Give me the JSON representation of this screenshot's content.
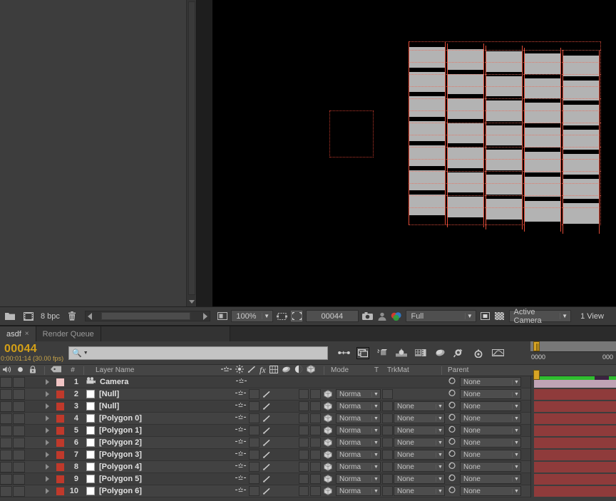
{
  "project_panel": {
    "bit_depth": "8 bpc",
    "folder_icon": "folder-icon",
    "comp_icon": "comp-icon",
    "delete_icon": "trash-icon"
  },
  "viewer_toolbar": {
    "region_icon": "region-of-interest-icon",
    "zoom": "100%",
    "grid_icon": "grid-guides-icon",
    "roi_icon": "region-crop-icon",
    "timecode": "00044",
    "snapshot_icon": "camera-icon",
    "show_snapshot_icon": "person-icon",
    "channels_icon": "channels-icon",
    "resolution": "Full",
    "mask_icon": "mask-icon",
    "transparency_icon": "transparency-grid-icon",
    "view": "Active Camera",
    "views": "1 View"
  },
  "tabs": [
    {
      "label": "asdf",
      "active": true,
      "close": "×"
    },
    {
      "label": "Render Queue",
      "active": false,
      "close": ""
    }
  ],
  "timeline": {
    "current_time": "00044",
    "time_detail": "0:00:01:14 (30.00 fps)",
    "search_placeholder": "",
    "search_value": "",
    "switches": [
      "live-update-icon",
      "draft-3d-icon",
      "motion-blur-icon",
      "graph-editor-icon",
      "hide-shy-icon",
      "frame-blend-icon",
      "brainstorm-icon",
      "auto-keyframe-icon"
    ],
    "ruler_labels": [
      "0000",
      "000"
    ],
    "columns": {
      "av_a": "audio-icon",
      "av_v": "eye-icon",
      "av_s": "solo-icon",
      "av_l": "lock-icon",
      "tag": "label-icon",
      "number": "#",
      "name": "Layer Name",
      "switch_icons": [
        "shy-icon",
        "collapse-icon",
        "quality-icon",
        "effects-icon",
        "frame-blend-icon",
        "motion-blur-icon",
        "adjustment-icon",
        "three-d-icon"
      ],
      "mode": "Mode",
      "t": "T",
      "trkmat": "TrkMat",
      "parent": "Parent"
    },
    "layers": [
      {
        "num": "1",
        "name": "Camera",
        "color": "#f0c4c4",
        "type": "camera",
        "icon": "camera-layer-icon",
        "mode": "",
        "trkmat": "",
        "parent": "None",
        "has_mode": false,
        "has_trkmat": false,
        "bar_color": "#bfa3b5"
      },
      {
        "num": "2",
        "name": "[Null]",
        "color": "#c0392b",
        "type": "null",
        "icon": "solid-icon",
        "mode": "Norma",
        "trkmat": "",
        "parent": "None",
        "has_mode": true,
        "has_trkmat": false,
        "bar_color": "#8f3b3b"
      },
      {
        "num": "3",
        "name": "[Null]",
        "color": "#c0392b",
        "type": "null",
        "icon": "solid-icon",
        "mode": "Norma",
        "trkmat": "None",
        "parent": "None",
        "has_mode": true,
        "has_trkmat": true,
        "bar_color": "#8f3b3b"
      },
      {
        "num": "4",
        "name": "[Polygon 0]",
        "color": "#c0392b",
        "type": "solid",
        "icon": "solid-icon",
        "mode": "Norma",
        "trkmat": "None",
        "parent": "None",
        "has_mode": true,
        "has_trkmat": true,
        "bar_color": "#8f3b3b"
      },
      {
        "num": "5",
        "name": "[Polygon 1]",
        "color": "#c0392b",
        "type": "solid",
        "icon": "solid-icon",
        "mode": "Norma",
        "trkmat": "None",
        "parent": "None",
        "has_mode": true,
        "has_trkmat": true,
        "bar_color": "#8f3b3b"
      },
      {
        "num": "6",
        "name": "[Polygon 2]",
        "color": "#c0392b",
        "type": "solid",
        "icon": "solid-icon",
        "mode": "Norma",
        "trkmat": "None",
        "parent": "None",
        "has_mode": true,
        "has_trkmat": true,
        "bar_color": "#8f3b3b"
      },
      {
        "num": "7",
        "name": "[Polygon 3]",
        "color": "#c0392b",
        "type": "solid",
        "icon": "solid-icon",
        "mode": "Norma",
        "trkmat": "None",
        "parent": "None",
        "has_mode": true,
        "has_trkmat": true,
        "bar_color": "#8f3b3b"
      },
      {
        "num": "8",
        "name": "[Polygon 4]",
        "color": "#c0392b",
        "type": "solid",
        "icon": "solid-icon",
        "mode": "Norma",
        "trkmat": "None",
        "parent": "None",
        "has_mode": true,
        "has_trkmat": true,
        "bar_color": "#8f3b3b"
      },
      {
        "num": "9",
        "name": "[Polygon 5]",
        "color": "#c0392b",
        "type": "solid",
        "icon": "solid-icon",
        "mode": "Norma",
        "trkmat": "None",
        "parent": "None",
        "has_mode": true,
        "has_trkmat": true,
        "bar_color": "#8f3b3b"
      },
      {
        "num": "10",
        "name": "[Polygon 6]",
        "color": "#c0392b",
        "type": "solid",
        "icon": "solid-icon",
        "mode": "Norma",
        "trkmat": "None",
        "parent": "None",
        "has_mode": true,
        "has_trkmat": true,
        "bar_color": "#8f3b3b"
      }
    ]
  },
  "composition": {
    "background": "#000000",
    "null_outline_color": "#c0392b",
    "polygon_fill": "#b3b3b3",
    "layer_outline_color": "#e04a36",
    "strip_count": 5,
    "row_count": 7
  },
  "colors": {
    "panel_bg": "#3d3d3d",
    "panel_dark": "#2b2b2b",
    "accent_time": "#d4a017",
    "work_area_green": "#2fbe2f"
  }
}
